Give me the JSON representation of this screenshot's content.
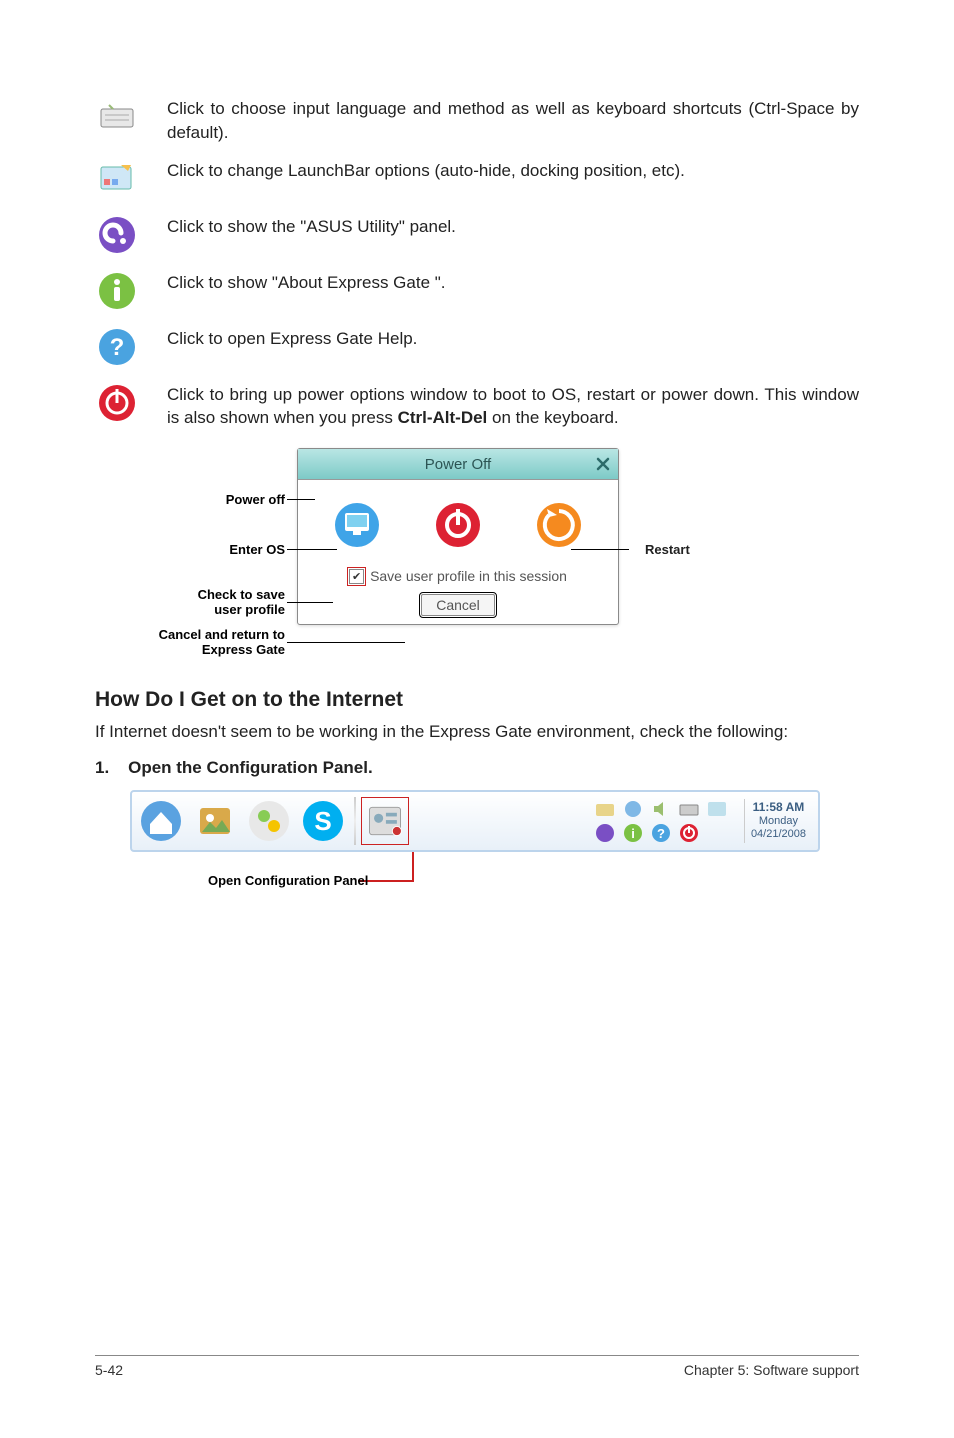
{
  "icons": [
    {
      "name": "keyboard-icon",
      "desc": "Click to choose input language and method as well as keyboard shortcuts (Ctrl-Space by default)."
    },
    {
      "name": "launchbar-options-icon",
      "desc": "Click to change LaunchBar options (auto-hide, docking position, etc)."
    },
    {
      "name": "asus-utility-icon",
      "desc": "Click to show the \"ASUS Utility\" panel."
    },
    {
      "name": "about-icon",
      "desc": "Click to show \"About Express Gate \"."
    },
    {
      "name": "help-icon",
      "desc": "Click to open Express Gate  Help."
    },
    {
      "name": "power-icon",
      "desc": "Click to bring up power options window to boot to OS, restart or power down. This window is also shown when you press Ctrl-Alt-Del on the keyboard."
    }
  ],
  "power_desc_prefix": "Click to bring up power options window to boot to OS, restart or power down. This window is also shown when you press ",
  "power_desc_bold": "Ctrl-Alt-Del",
  "power_desc_suffix": " on the keyboard.",
  "poweroff": {
    "title": "Power Off",
    "labels": {
      "poweroff": "Power off",
      "enteros": "Enter OS",
      "check_l1": "Check to save",
      "check_l2": "user profile",
      "cancel_l1": "Cancel and return to",
      "cancel_l2": "Express Gate",
      "restart": "Restart"
    },
    "checkbox_label": "Save user profile in this session",
    "cancel_button": "Cancel"
  },
  "heading": "How Do I Get on to the Internet",
  "body": "If Internet doesn't seem to be working in the Express Gate  environment, check the following:",
  "step1_num": "1.",
  "step1_text": "Open the Configuration Panel.",
  "launchbar_caption": "Open Configuration Panel",
  "clock": {
    "time": "11:58 AM",
    "day": "Monday",
    "date": "04/21/2008"
  },
  "footer": {
    "left": "5-42",
    "right": "Chapter 5: Software support"
  }
}
